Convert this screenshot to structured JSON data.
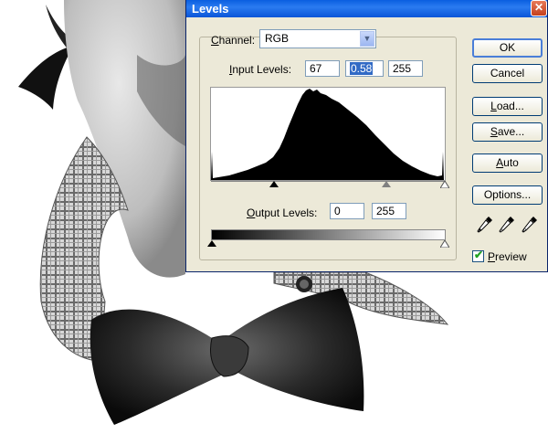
{
  "dialog": {
    "title": "Levels",
    "close_glyph": "✕"
  },
  "channel": {
    "label_prefix": "C",
    "label_rest": "hannel:",
    "value": "RGB",
    "arrow_glyph": "▼"
  },
  "input_levels": {
    "label_prefix": "I",
    "label_rest": "nput Levels:",
    "black": "67",
    "gamma": "0.58",
    "white": "255"
  },
  "output_levels": {
    "label_prefix": "O",
    "label_rest": "utput Levels:",
    "black": "0",
    "white": "255"
  },
  "buttons": {
    "ok": "OK",
    "cancel": "Cancel",
    "load_prefix": "L",
    "load_rest": "oad...",
    "save_prefix": "S",
    "save_rest": "ave...",
    "auto_prefix": "A",
    "auto_rest": "uto",
    "options_prefix": "Op",
    "options_rest": "tions..."
  },
  "preview": {
    "label_prefix": "P",
    "label_rest": "review",
    "checked": true,
    "check_glyph": "✔"
  },
  "icons": {
    "black_eyedropper": "eyedropper-black-icon",
    "gray_eyedropper": "eyedropper-gray-icon",
    "white_eyedropper": "eyedropper-white-icon"
  },
  "colors": {
    "titlebar": "#0a5ee0",
    "dialog_bg": "#ece9d8",
    "selection": "#316ac5"
  }
}
